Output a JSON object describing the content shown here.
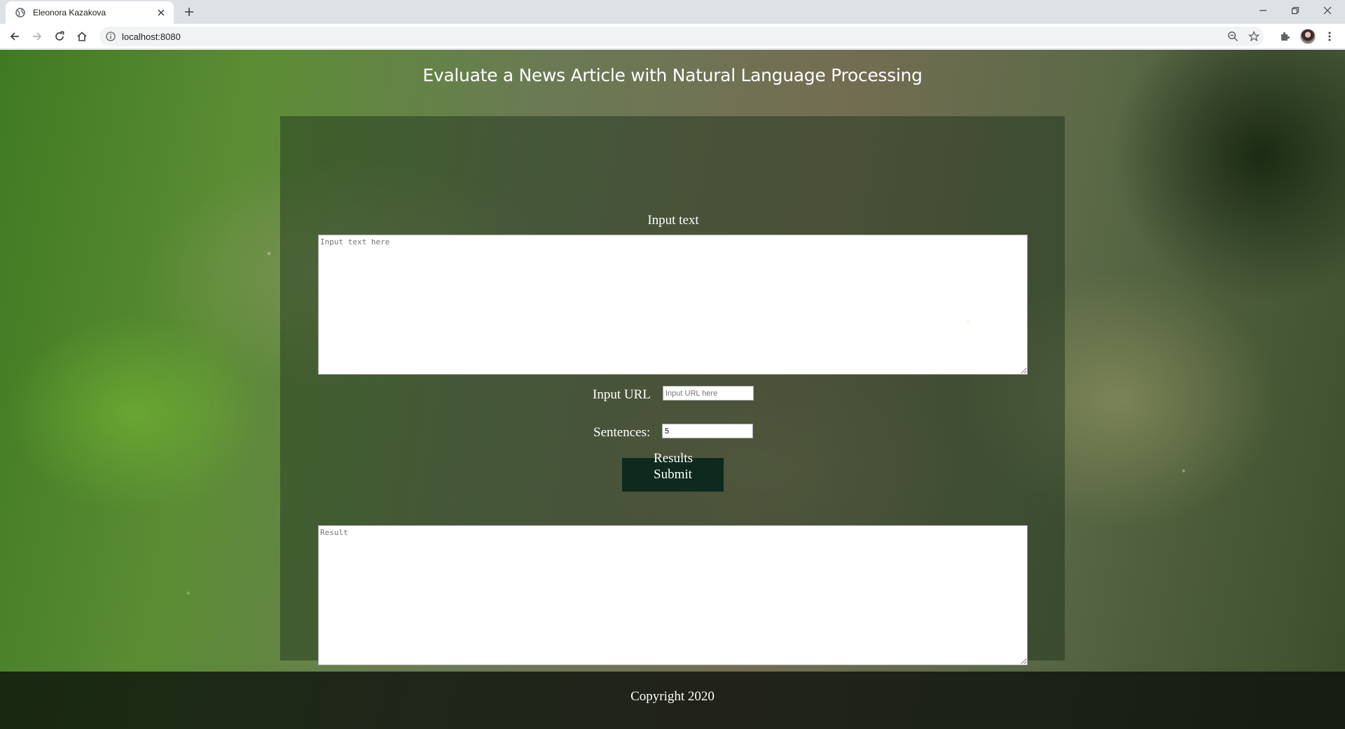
{
  "browser": {
    "tab": {
      "title": "Eleonora Kazakova",
      "favicon": "globe-icon"
    },
    "address_bar": {
      "url": "localhost:8080"
    },
    "icons": [
      "back-icon",
      "forward-icon",
      "reload-icon",
      "home-icon",
      "info-icon",
      "zoom-icon",
      "star-icon",
      "extensions-icon",
      "avatar",
      "menu-icon",
      "minimize-icon",
      "restore-icon",
      "close-icon",
      "new-tab-icon"
    ]
  },
  "page": {
    "title": "Evaluate a News Article with Natural Language Processing",
    "input_section": {
      "label": "Input text",
      "textarea_placeholder": "Input text here"
    },
    "url_field": {
      "label": "Input URL",
      "placeholder": "Input URL here"
    },
    "sentences_field": {
      "label": "Sentences:",
      "value": "5"
    },
    "submit_label": "Submit",
    "results_section": {
      "label": "Results",
      "textarea_placeholder": "Result"
    },
    "footer_text": "Copyright 2020"
  },
  "colors": {
    "submit_bg": "#0e2a1e",
    "footer_bg": "#0a0e0a",
    "tabstrip_bg": "#dee1e6"
  }
}
